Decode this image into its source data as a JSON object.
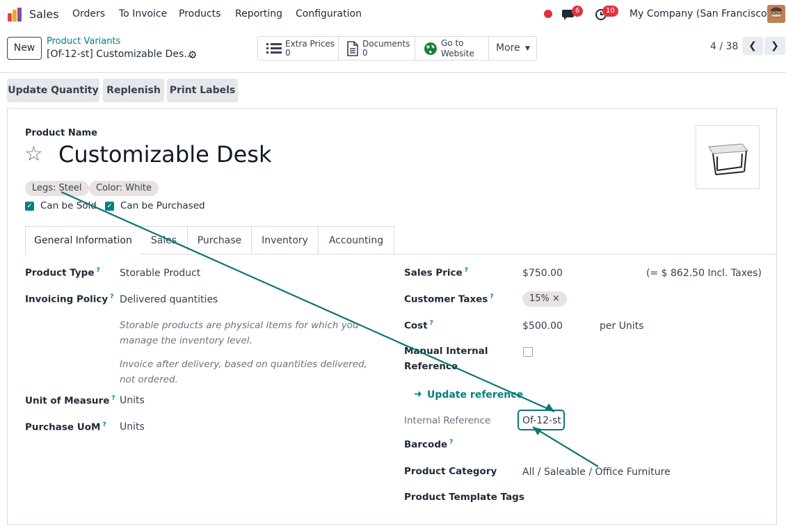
{
  "nav": {
    "app_name": "Sales",
    "menu": [
      "Orders",
      "To Invoice",
      "Products",
      "Reporting",
      "Configuration"
    ],
    "messages_count": "6",
    "activities_count": "10",
    "company": "My Company (San Francisco)"
  },
  "control": {
    "new_label": "New",
    "breadcrumb": "Product Variants",
    "record_name": "[Of-12-st] Customizable Des...",
    "smart_buttons": {
      "extra_prices": {
        "label": "Extra Prices",
        "value": "0"
      },
      "documents": {
        "label": "Documents",
        "value": "0"
      },
      "website": {
        "line1": "Go to",
        "line2": "Website"
      },
      "more": "More"
    },
    "pager": "4 / 38"
  },
  "actions": [
    "Update Quantity",
    "Replenish",
    "Print Labels"
  ],
  "product": {
    "name_label": "Product Name",
    "name": "Customizable Desk",
    "attributes": [
      "Legs: Steel",
      "Color: White"
    ],
    "can_be_sold": "Can be Sold",
    "can_be_purchased": "Can be Purchased"
  },
  "tabs": [
    "General Information",
    "Sales",
    "Purchase",
    "Inventory",
    "Accounting"
  ],
  "left": {
    "product_type": {
      "label": "Product Type",
      "value": "Storable Product"
    },
    "invoicing_policy": {
      "label": "Invoicing Policy",
      "value": "Delivered quantities"
    },
    "help1": "Storable products are physical items for which you manage the inventory level.",
    "help2": "Invoice after delivery, based on quantities delivered, not ordered.",
    "uom": {
      "label": "Unit of Measure",
      "value": "Units"
    },
    "purchase_uom": {
      "label": "Purchase UoM",
      "value": "Units"
    }
  },
  "right": {
    "sales_price": {
      "label": "Sales Price",
      "value": "$750.00",
      "incl": "(= $ 862.50 Incl. Taxes)"
    },
    "customer_taxes": {
      "label": "Customer Taxes",
      "tag": "15%"
    },
    "cost": {
      "label": "Cost",
      "value": "$500.00",
      "per": "per Units"
    },
    "manual_ref": {
      "label_line1": "Manual Internal",
      "label_line2": "Reference"
    },
    "update_reference": "Update reference",
    "internal_reference": {
      "label": "Internal Reference",
      "value": "Of-12-st"
    },
    "barcode": {
      "label": "Barcode"
    },
    "product_category": {
      "label": "Product Category",
      "value": "All / Saleable / Office Furniture"
    },
    "template_tags": {
      "label": "Product Template Tags"
    }
  },
  "colors": {
    "accent": "#017e84",
    "badge": "#e3313b",
    "arrow": "#0b7575"
  }
}
